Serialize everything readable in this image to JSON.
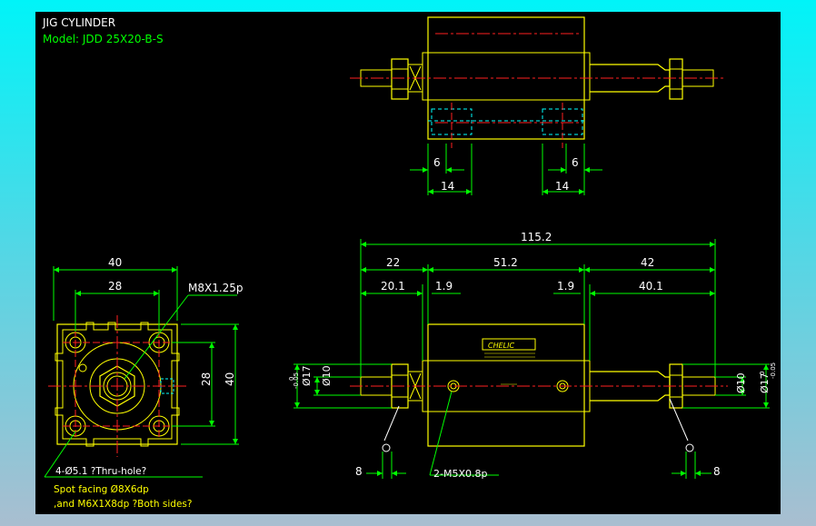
{
  "title": "JIG CYLINDER",
  "model": "Model:  JDD 25X20-B-S",
  "colors": {
    "yellow": "#ffff00",
    "green": "#00ff00",
    "red": "#ff2020",
    "cyan": "#00ffff",
    "white": "#ffffff"
  },
  "top_view": {
    "dim_left_small": "6",
    "dim_right_small": "6",
    "dim_left_big": "14",
    "dim_right_big": "14"
  },
  "front_view": {
    "dim_width": "40",
    "dim_inner": "28",
    "dim_height_outer": "40",
    "dim_height_inner": "28",
    "thread_label": "M8X1.25p",
    "note1": "4-Ø5.1 ?Thru-hole?",
    "note2": "Spot facing  Ø8X6dp",
    "note3": ",and M6X1X8dp ?Both sides?"
  },
  "side_view": {
    "dim_total": "115.2",
    "dim_left": "22",
    "dim_mid": "51.2",
    "dim_right": "42",
    "dim_left_sub": "20.1",
    "dim_gap_left": "1.9",
    "dim_gap_right": "1.9",
    "dim_right_sub": "40.1",
    "dia_left": "Ø10",
    "dia_left_tol": "Ø17",
    "tol_upper": "0",
    "tol_lower": "-0.05",
    "dia_right": "Ø10",
    "dia_right_tol": "Ø17",
    "dim_bottom_left": "8",
    "dim_bottom_right": "8",
    "port_label": "2-M5X0.8p",
    "brand_label": "CHELIC"
  }
}
